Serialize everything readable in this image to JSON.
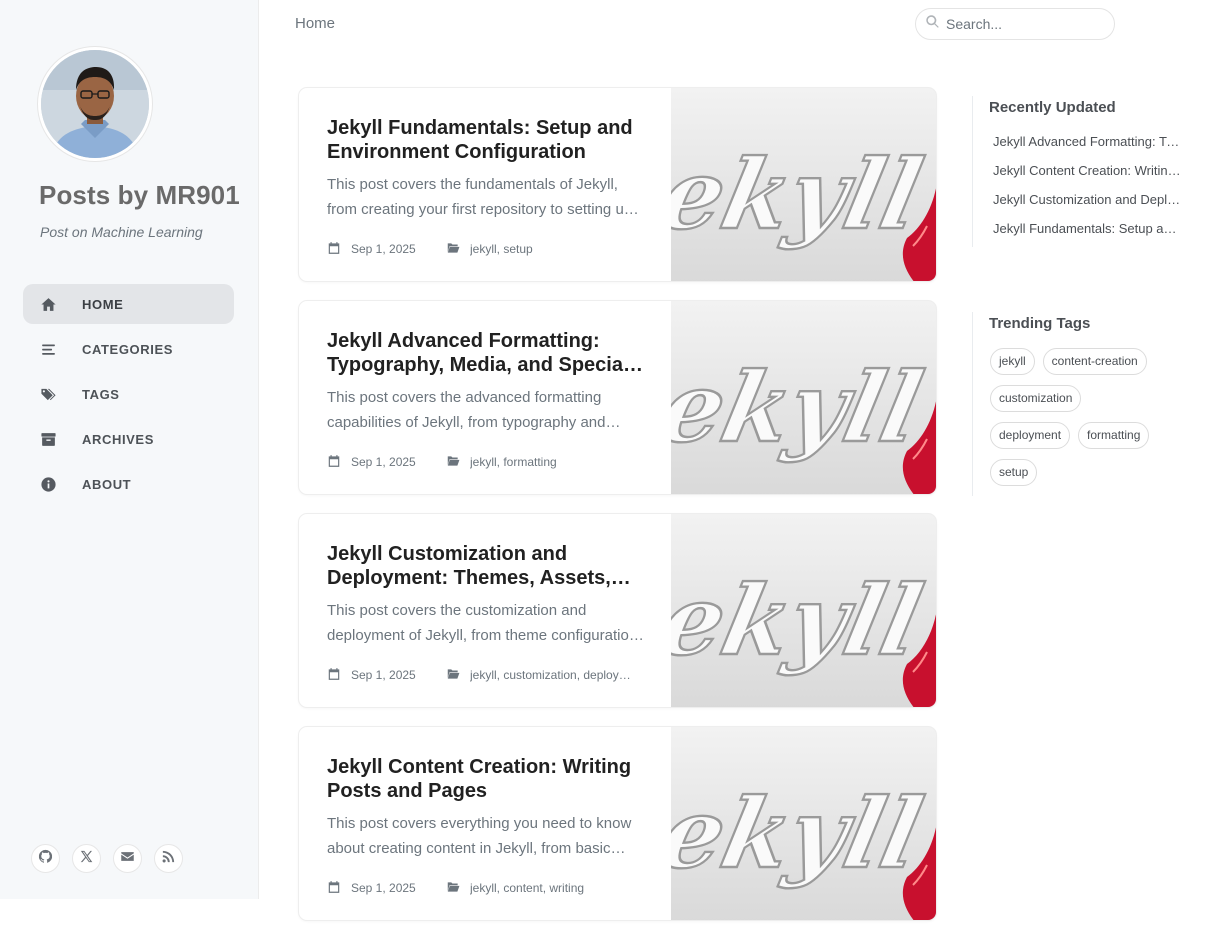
{
  "site": {
    "title": "Posts by MR901",
    "subtitle": "Post on Machine Learning"
  },
  "nav": [
    {
      "label": "HOME",
      "icon": "home-icon",
      "active": true
    },
    {
      "label": "CATEGORIES",
      "icon": "stream-icon",
      "active": false
    },
    {
      "label": "TAGS",
      "icon": "tags-icon",
      "active": false
    },
    {
      "label": "ARCHIVES",
      "icon": "archive-icon",
      "active": false
    },
    {
      "label": "ABOUT",
      "icon": "info-circle-icon",
      "active": false
    }
  ],
  "social": [
    "github-icon",
    "x-twitter-icon",
    "email-icon",
    "rss-icon"
  ],
  "topbar": {
    "breadcrumb": "Home",
    "search_placeholder": "Search..."
  },
  "posts": [
    {
      "title": "Jekyll Fundamentals: Setup and Environment Configuration",
      "excerpt": "This post covers the fundamentals of Jekyll, from creating your first repository to setting up your local environment.",
      "date": "Sep 1, 2025",
      "categories": "jekyll, setup"
    },
    {
      "title": "Jekyll Advanced Formatting: Typography, Media, and Special Elements",
      "excerpt": "This post covers the advanced formatting capabilities of Jekyll, from typography and media to special elements.",
      "date": "Sep 1, 2025",
      "categories": "jekyll, formatting"
    },
    {
      "title": "Jekyll Customization and Deployment: Themes, Assets, and Hosting",
      "excerpt": "This post covers the customization and deployment of Jekyll, from theme configuration to hosting your site.",
      "date": "Sep 1, 2025",
      "categories": "jekyll, customization, deployment"
    },
    {
      "title": "Jekyll Content Creation: Writing Posts and Pages",
      "excerpt": "This post covers everything you need to know about creating content in Jekyll, from basic posts to pages.",
      "date": "Sep 1, 2025",
      "categories": "jekyll, content, writing"
    }
  ],
  "recently_updated": {
    "heading": "Recently Updated",
    "items": [
      "Jekyll Advanced Formatting: Typography, Media, and Special Elements",
      "Jekyll Content Creation: Writing Posts and Pages",
      "Jekyll Customization and Deployment: Themes, Assets, and Hosting",
      "Jekyll Fundamentals: Setup and Environment Configuration"
    ]
  },
  "trending_tags": {
    "heading": "Trending Tags",
    "tags": [
      "jekyll",
      "content-creation",
      "customization",
      "deployment",
      "formatting",
      "setup"
    ]
  },
  "thumbnail_text": "jekyll",
  "colors": {
    "sidebar_bg": "#f6f8fa",
    "active_nav_bg": "#e3e5e8",
    "muted_text": "#6c757d",
    "jekyll_red": "#c8102e"
  }
}
